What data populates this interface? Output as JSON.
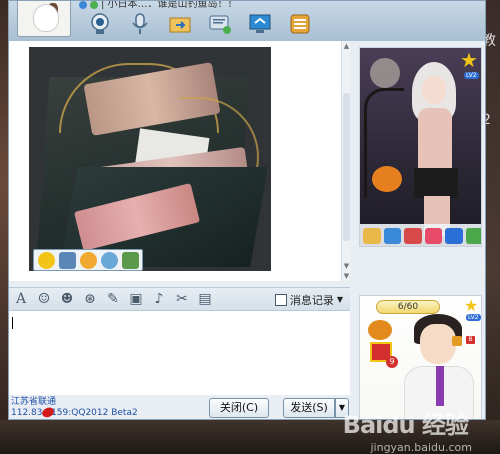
{
  "window": {
    "status_text": "| 小日本…．谁是山钓鱼岛！！"
  },
  "toolbar": {
    "icons": [
      "video-call-icon",
      "voice-call-icon",
      "send-file-icon",
      "create-group-icon",
      "remote-assist-icon",
      "app-box-icon"
    ]
  },
  "message_area": {
    "image_toolbar_icons": [
      "emoticon-icon",
      "save-icon",
      "favorite-icon",
      "search-icon",
      "image-icon"
    ]
  },
  "format_bar": {
    "icons": [
      "font-icon",
      "emoticon-icon",
      "magic-expression-icon",
      "shake-icon",
      "doodle-icon",
      "image-icon",
      "music-icon",
      "screenshot-icon",
      "app-icon"
    ],
    "history_label": "消息记录"
  },
  "bottom": {
    "location": "江苏省联通",
    "ip_line": "112.83.  .159:QQ2012 Beta2",
    "close_button": "关闭(C)",
    "send_button": "发送(S)",
    "send_dropdown": "▼"
  },
  "right_panel": {
    "show1_level": "LV2",
    "show2_progress": "6/60",
    "show2_level": "LV2",
    "show2_badge": "9",
    "show2_side_label": "B"
  },
  "desktop": {
    "right_edge_text": [
      "教",
      "2"
    ]
  },
  "watermark": {
    "main": "Baidu 经验",
    "sub": "jingyan.baidu.com"
  }
}
